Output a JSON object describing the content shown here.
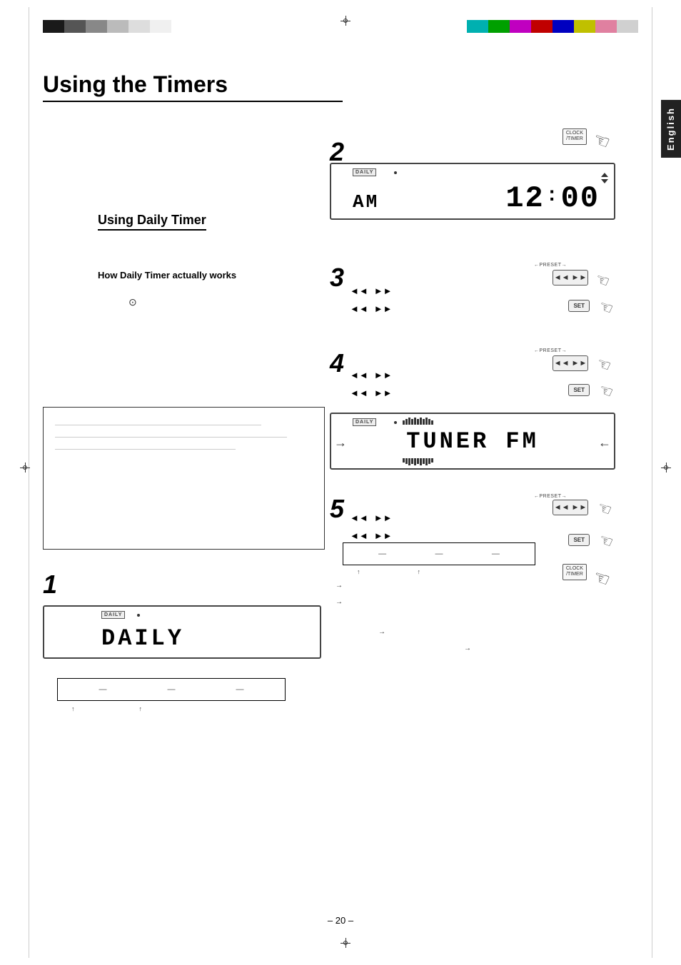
{
  "page": {
    "title": "Using the Timers",
    "page_number": "– 20 –",
    "language_tab": "English"
  },
  "sections": {
    "using_daily_timer": {
      "title": "Using Daily Timer",
      "subsection_title": "How Daily Timer actually works"
    }
  },
  "steps": {
    "step1": {
      "number": "1"
    },
    "step2": {
      "number": "2"
    },
    "step3": {
      "number": "3"
    },
    "step4": {
      "number": "4"
    },
    "step5": {
      "number": "5"
    }
  },
  "buttons": {
    "clock_timer": "CLOCK\n/TIMER",
    "set": "SET",
    "preset_minus_plus": "←PRESET→"
  },
  "lcd_displays": {
    "display1_text": "DAILY",
    "display2_text": "AM  12:00",
    "display3_text": "TUNER  FM",
    "display_daily_main": "DAILY"
  },
  "transport": {
    "prev": "◄◄",
    "next": "►►"
  },
  "note_box": {
    "content": ""
  }
}
